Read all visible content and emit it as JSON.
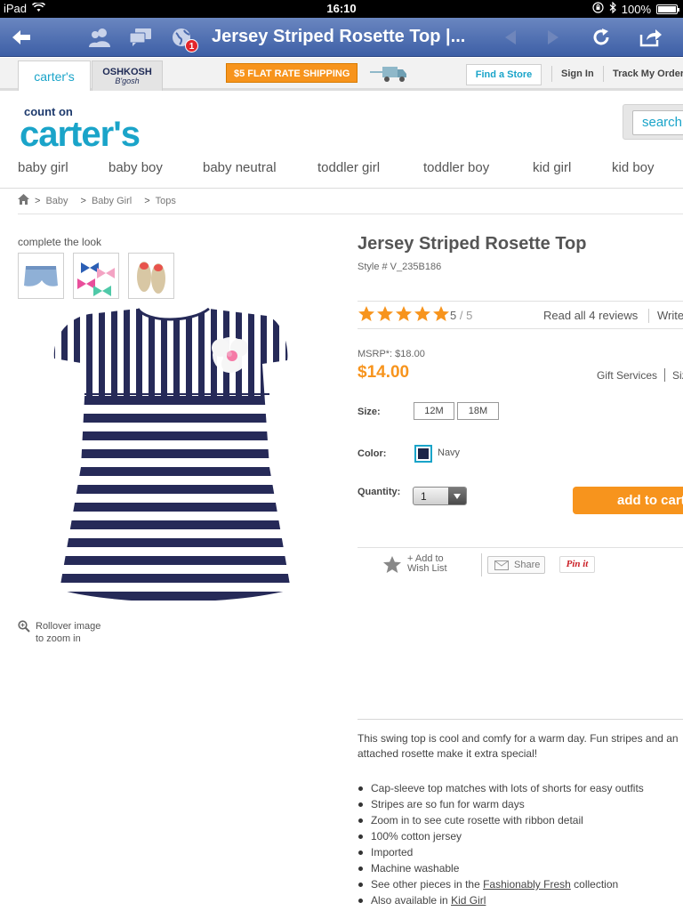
{
  "status_bar": {
    "device": "iPad",
    "time": "16:10",
    "battery": "100%"
  },
  "toolbar": {
    "title": "Jersey Striped Rosette Top |...",
    "notification_count": "1"
  },
  "brand_tabs": [
    {
      "label": "carter's"
    },
    {
      "label": "OSHKOSH",
      "sub": "B'gosh"
    }
  ],
  "utility": {
    "shipping_banner": "$5 FLAT RATE SHIPPING",
    "find_store": "Find a Store",
    "sign_in": "Sign In",
    "track_order": "Track My Order"
  },
  "logo": {
    "tagline": "count on",
    "wordmark": "carter's"
  },
  "search": {
    "placeholder": "search"
  },
  "categories": [
    "baby girl",
    "baby boy",
    "baby neutral",
    "toddler girl",
    "toddler boy",
    "kid girl",
    "kid boy"
  ],
  "breadcrumb": [
    "Baby",
    "Baby Girl",
    "Tops"
  ],
  "complete_the_look": {
    "label": "complete the look"
  },
  "zoom_hint": {
    "line1": "Rollover image",
    "line2": "to zoom in"
  },
  "product": {
    "title": "Jersey Striped Rosette Top",
    "style": "Style # V_235B186",
    "rating": "5",
    "rating_max": "/ 5",
    "stars": 5,
    "read_reviews": "Read all 4 reviews",
    "write_review": "Write",
    "msrp": "MSRP*: $18.00",
    "price": "$14.00",
    "gift_services": "Gift Services",
    "size_chart": "Size",
    "size_label": "Size:",
    "sizes": [
      "12M",
      "18M"
    ],
    "color_label": "Color:",
    "color_name": "Navy",
    "color_hex": "#1c2447",
    "quantity_label": "Quantity:",
    "quantity": "1",
    "add_to_cart": "add to cart"
  },
  "actions": {
    "wishlist_line1": "+ Add to",
    "wishlist_line2": "Wish List",
    "share": "Share",
    "pinit": "Pin it"
  },
  "description": {
    "text": "This swing top is cool and comfy for a warm day. Fun stripes and an attached rosette make it extra special!",
    "bullets": [
      "Cap-sleeve top matches with lots of shorts for easy outfits",
      "Stripes are so fun for warm days",
      "Zoom in to see cute rosette with ribbon detail",
      "100% cotton jersey",
      "Imported",
      "Machine washable"
    ],
    "see_other_prefix": "See other pieces in the ",
    "see_other_link": "Fashionably Fresh",
    "see_other_suffix": " collection",
    "also_prefix": "Also available in ",
    "also_link": "Kid Girl"
  },
  "colors": {
    "accent": "#1aa4c9",
    "orange": "#f7941d",
    "toolbar": "#4a6aae"
  }
}
